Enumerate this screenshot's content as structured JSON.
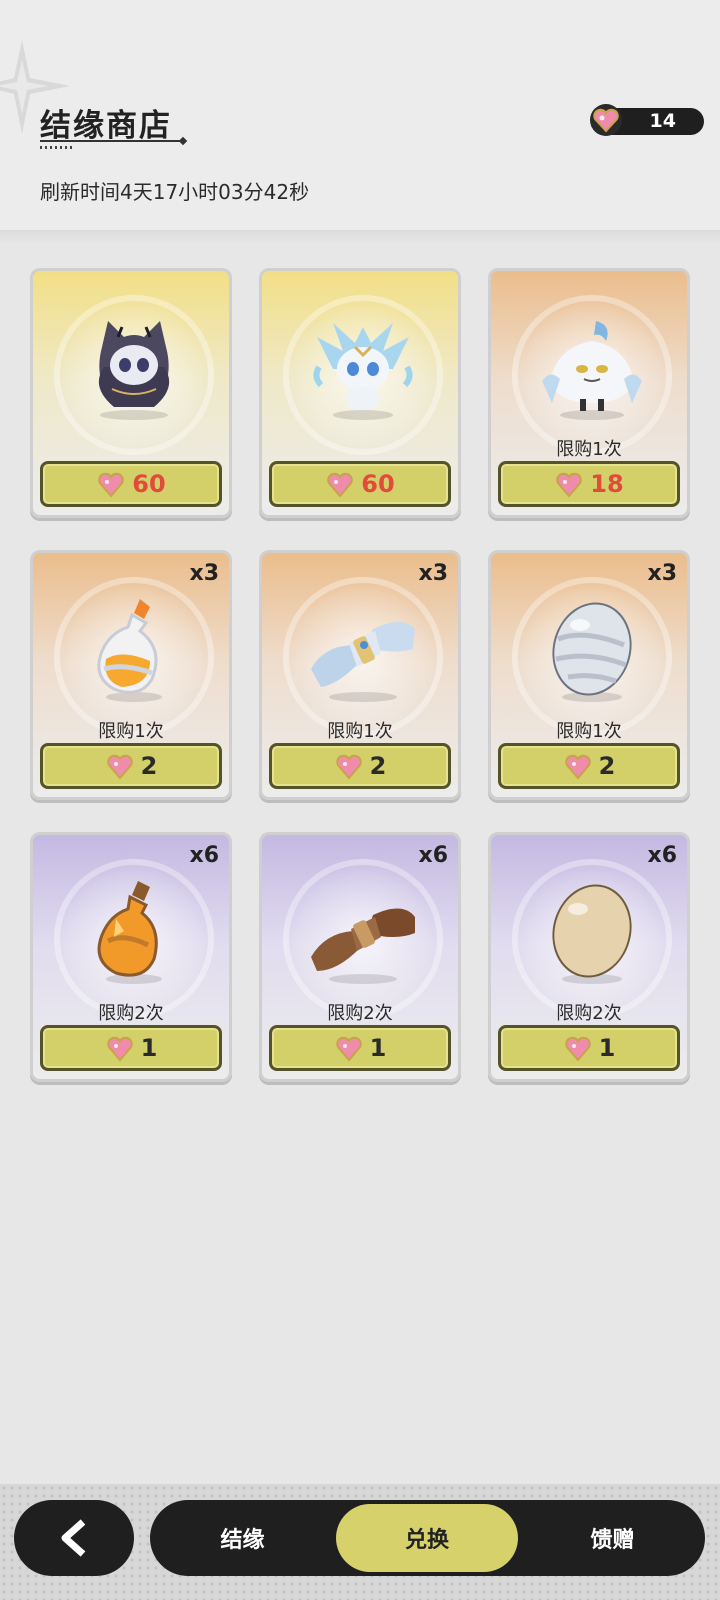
{
  "header": {
    "title": "结缘商店",
    "refresh_text": "刷新时间4天17小时03分42秒",
    "currency": {
      "icon": "heart-gem-icon",
      "count": "14"
    }
  },
  "items": [
    {
      "tier": "yellow",
      "art": "dark-cat-creature",
      "quantity": "",
      "limit": "",
      "price": "60",
      "price_color": "#e24a3b"
    },
    {
      "tier": "yellow",
      "art": "crystal-fox-creature",
      "quantity": "",
      "limit": "",
      "price": "60",
      "price_color": "#e24a3b"
    },
    {
      "tier": "orange",
      "art": "ghost-unicorn-creature",
      "quantity": "",
      "limit": "限购1次",
      "price": "18",
      "price_color": "#e24a3b"
    },
    {
      "tier": "orange",
      "art": "potion-bottle",
      "quantity": "x3",
      "limit": "限购1次",
      "price": "2",
      "price_color": "#2a2a2a"
    },
    {
      "tier": "orange",
      "art": "silk-bundle",
      "quantity": "x3",
      "limit": "限购1次",
      "price": "2",
      "price_color": "#2a2a2a"
    },
    {
      "tier": "orange",
      "art": "marble-egg",
      "quantity": "x3",
      "limit": "限购1次",
      "price": "2",
      "price_color": "#2a2a2a"
    },
    {
      "tier": "purple",
      "art": "amber-bottle",
      "quantity": "x6",
      "limit": "限购2次",
      "price": "1",
      "price_color": "#2a2a2a"
    },
    {
      "tier": "purple",
      "art": "wood-bundle",
      "quantity": "x6",
      "limit": "限购2次",
      "price": "1",
      "price_color": "#2a2a2a"
    },
    {
      "tier": "purple",
      "art": "plain-egg",
      "quantity": "x6",
      "limit": "限购2次",
      "price": "1",
      "price_color": "#2a2a2a"
    }
  ],
  "nav": {
    "back_icon": "chevron-left-icon",
    "tabs": [
      {
        "label": "结缘",
        "active": false
      },
      {
        "label": "兑换",
        "active": true
      },
      {
        "label": "馈赠",
        "active": false
      }
    ]
  },
  "colors": {
    "accent": "#d6d16b",
    "dark": "#1f1f1f",
    "price_red": "#e24a3b"
  }
}
